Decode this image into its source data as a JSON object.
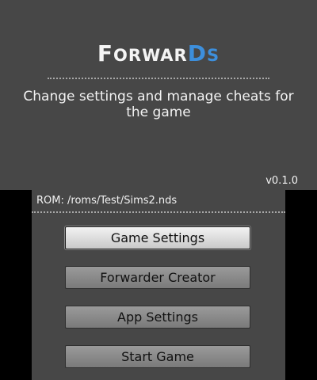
{
  "top": {
    "logo_part1_big": "F",
    "logo_part1_small": "ORWAR",
    "logo_part2_big": "D",
    "logo_part2_small": "S",
    "subtitle": "Change settings and manage cheats for the game",
    "version": "v0.1.0"
  },
  "bottom": {
    "rom_label": "ROM:",
    "rom_path": "/roms/Test/Sims2.nds",
    "buttons": [
      {
        "label": "Game Settings",
        "selected": true
      },
      {
        "label": "Forwarder Creator",
        "selected": false
      },
      {
        "label": "App Settings",
        "selected": false
      },
      {
        "label": "Start Game",
        "selected": false
      }
    ]
  },
  "colors": {
    "background": "#474747",
    "logo_accent": "#3d8fdc",
    "text": "#f2f2f2"
  }
}
